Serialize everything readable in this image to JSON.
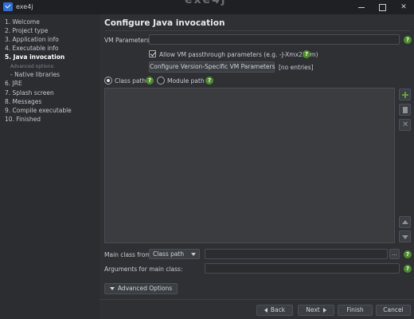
{
  "window": {
    "title": "exe4j",
    "watermark": "exe4j"
  },
  "sidebar": {
    "items": [
      {
        "label": "1. Welcome"
      },
      {
        "label": "2. Project type"
      },
      {
        "label": "3. Application info"
      },
      {
        "label": "4. Executable info"
      },
      {
        "label": "5. Java invocation"
      },
      {
        "label": "6. JRE"
      },
      {
        "label": "7. Splash screen"
      },
      {
        "label": "8. Messages"
      },
      {
        "label": "9. Compile executable"
      },
      {
        "label": "10. Finished"
      }
    ],
    "sub_heading": "Advanced options:",
    "sub_item": "-  Native libraries",
    "active_index": 4
  },
  "main": {
    "title": "Configure Java invocation",
    "vm_parameters_label": "VM Parameters:",
    "vm_parameters_value": "",
    "allow_passthrough_label": "Allow VM passthrough parameters (e.g. -J-Xmx256m)",
    "allow_passthrough_checked": true,
    "configure_vm_button": "Configure Version-Specific VM Parameters",
    "no_entries": "[no entries]",
    "class_path_label": "Class path",
    "module_path_label": "Module path",
    "class_path_selected": true,
    "main_class_from_label": "Main class from",
    "main_class_from_value": "Class path",
    "main_class_value": "",
    "browse_label": "...",
    "arguments_label": "Arguments for main class:",
    "arguments_value": "",
    "advanced_options_button": "Advanced Options"
  },
  "footer": {
    "back": "Back",
    "next": "Next",
    "finish": "Finish",
    "cancel": "Cancel"
  },
  "icons": {
    "help": "help-icon",
    "add": "add-icon",
    "edit": "edit-icon",
    "remove": "remove-icon",
    "move_up": "move-up-icon",
    "move_down": "move-down-icon"
  },
  "colors": {
    "background": "#2b2d30",
    "panel": "#2e3033",
    "help_green": "#4e8a2e",
    "add_green": "#5ea33a"
  }
}
